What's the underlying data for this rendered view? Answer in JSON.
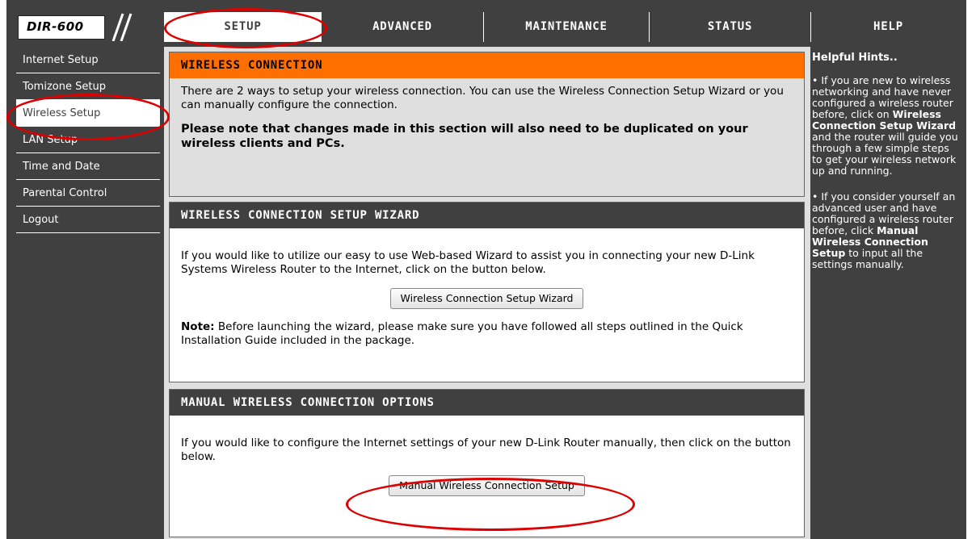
{
  "logo": {
    "model": "DIR-600"
  },
  "tabs": [
    {
      "label": "SETUP",
      "active": true
    },
    {
      "label": "ADVANCED",
      "active": false
    },
    {
      "label": "MAINTENANCE",
      "active": false
    },
    {
      "label": "STATUS",
      "active": false
    },
    {
      "label": "HELP",
      "active": false
    }
  ],
  "sidebar": {
    "items": [
      {
        "label": "Internet Setup",
        "active": false
      },
      {
        "label": "Tomizone Setup",
        "active": false
      },
      {
        "label": "Wireless Setup",
        "active": true
      },
      {
        "label": "LAN Setup",
        "active": false
      },
      {
        "label": "Time and Date",
        "active": false
      },
      {
        "label": "Parental Control",
        "active": false
      },
      {
        "label": "Logout",
        "active": false
      }
    ]
  },
  "main": {
    "wireless_connection": {
      "title": "WIRELESS CONNECTION",
      "intro": "There are 2 ways to setup your wireless connection. You can use the Wireless Connection Setup Wizard or you can manually configure the connection.",
      "note": "Please note that changes made in this section will also need to be duplicated on your wireless clients and PCs."
    },
    "wizard": {
      "title": "WIRELESS CONNECTION SETUP WIZARD",
      "text": "If you would like to utilize our easy to use Web-based Wizard to assist you in connecting your new D-Link Systems Wireless Router to the Internet, click on the button below.",
      "button": "Wireless Connection Setup Wizard",
      "note_label": "Note:",
      "note_text": " Before launching the wizard, please make sure you have followed all steps outlined in the Quick Installation Guide included in the package."
    },
    "manual": {
      "title": "MANUAL WIRELESS CONNECTION OPTIONS",
      "text": "If you would like to configure the Internet settings of your new D-Link Router manually, then click on the button below.",
      "button": "Manual Wireless Connection Setup"
    }
  },
  "help": {
    "title": "Helpful Hints..",
    "hint1_a": "• If you are new to wireless networking and have never configured a wireless router before, click on ",
    "hint1_b": "Wireless Connection Setup Wizard",
    "hint1_c": " and the router will guide you through a few simple steps to get your wireless network up and running.",
    "hint2_a": "• If you consider yourself an advanced user and have configured a wireless router before, click ",
    "hint2_b": "Manual Wireless Connection Setup",
    "hint2_c": " to input all the settings manually."
  },
  "colors": {
    "accent": "#ff6f00",
    "frame": "#404040",
    "annotation": "#dd0000"
  }
}
